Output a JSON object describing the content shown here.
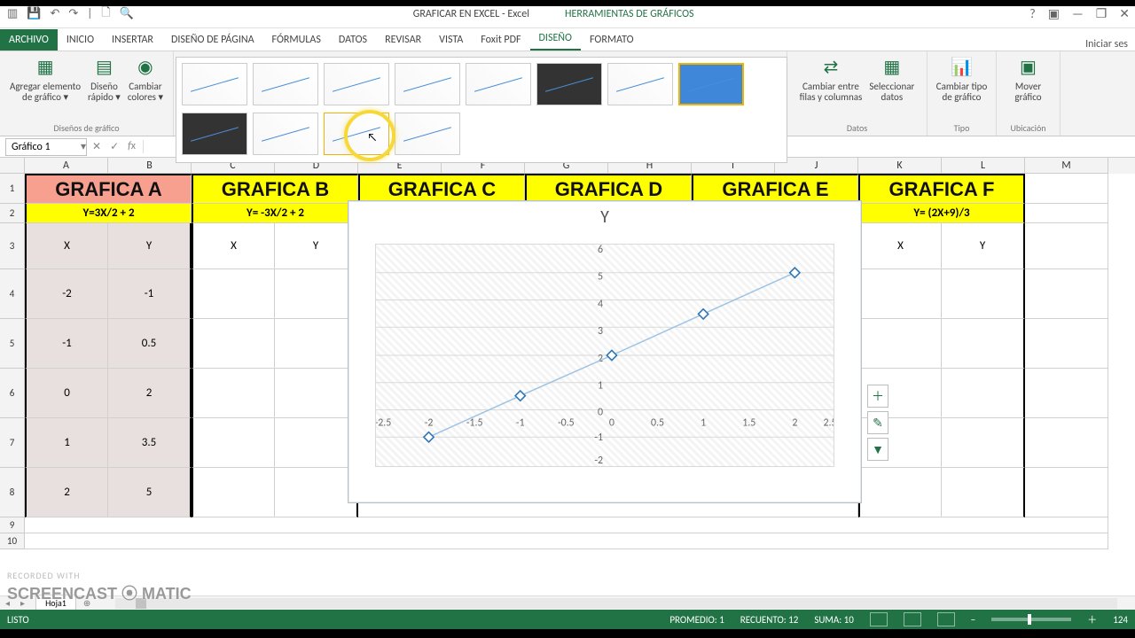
{
  "titlebar": {
    "docTitle": "GRAFICAR EN EXCEL - Excel",
    "toolTitle": "HERRAMIENTAS DE GRÁFICOS",
    "signin": "Iniciar ses"
  },
  "tabs": {
    "file": "ARCHIVO",
    "home": "INICIO",
    "insert": "INSERTAR",
    "layout": "DISEÑO DE PÁGINA",
    "formulas": "FÓRMULAS",
    "data": "DATOS",
    "review": "REVISAR",
    "view": "VISTA",
    "foxit": "Foxit PDF",
    "design": "DISEÑO",
    "format": "FORMATO"
  },
  "ribbon": {
    "addElement": "Agregar elemento\nde gráfico ▾",
    "quickLayout": "Diseño\nrápido ▾",
    "changeColors": "Cambiar\ncolores ▾",
    "group_designs": "Diseños de gráfico",
    "switchRC": "Cambiar entre\nfilas y columnas",
    "selectData": "Seleccionar\ndatos",
    "group_data": "Datos",
    "changeType": "Cambiar tipo\nde gráfico",
    "group_type": "Tipo",
    "moveChart": "Mover\ngráfico",
    "group_loc": "Ubicación"
  },
  "namebox": "Gráfico 1",
  "columns": [
    "A",
    "B",
    "C",
    "D",
    "E",
    "F",
    "G",
    "H",
    "I",
    "J",
    "K",
    "L",
    "M"
  ],
  "headers": {
    "a": "GRAFICA A",
    "b": "GRAFICA B",
    "c": "GRAFICA C",
    "d": "GRAFICA D",
    "e": "GRAFICA E",
    "f": "GRAFICA F"
  },
  "formulas": {
    "a": "Y=3X/2 + 2",
    "b": "Y= -3X/2  + 2",
    "f": "Y= (2X+9)/3"
  },
  "xy": {
    "x": "X",
    "y": "Y"
  },
  "dataA": {
    "x": [
      "-2",
      "-1",
      "0",
      "1",
      "2"
    ],
    "y": [
      "-1",
      "0.5",
      "2",
      "3.5",
      "5"
    ]
  },
  "chart_data": {
    "type": "scatter",
    "title": "Y",
    "xlabel": "",
    "ylabel": "",
    "xlim": [
      -2.5,
      2.5
    ],
    "ylim": [
      -2,
      6
    ],
    "xticks": [
      -2.5,
      -2,
      -1.5,
      -1,
      -0.5,
      0,
      0.5,
      1,
      1.5,
      2,
      2.5
    ],
    "yticks": [
      -2,
      -1,
      0,
      1,
      2,
      3,
      4,
      5,
      6
    ],
    "series": [
      {
        "name": "Y",
        "x": [
          -2,
          -1,
          0,
          1,
          2
        ],
        "y": [
          -1,
          0.5,
          2,
          3.5,
          5
        ]
      }
    ]
  },
  "status": {
    "ready": "LISTO",
    "avg": "PROMEDIO: 1",
    "count": "RECUENTO: 12",
    "sum": "SUMA: 10",
    "zoom": "124"
  },
  "sheet": "Hoja1",
  "watermark1": "RECORDED WITH",
  "watermark2": "SCREENCAST ⦿ MATIC"
}
